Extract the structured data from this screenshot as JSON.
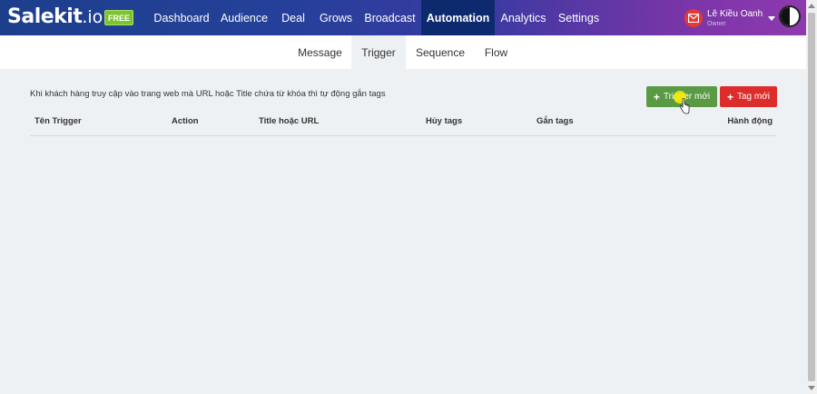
{
  "brand": {
    "name": "Salekit",
    "suffix": ".io",
    "badge": "FREE"
  },
  "nav": {
    "items": [
      {
        "label": "Dashboard"
      },
      {
        "label": "Audience"
      },
      {
        "label": "Deal"
      },
      {
        "label": "Grows"
      },
      {
        "label": "Broadcast"
      },
      {
        "label": "Automation",
        "active": true
      },
      {
        "label": "Analytics"
      },
      {
        "label": "Settings"
      }
    ]
  },
  "user": {
    "name": "Lê Kiều Oanh",
    "role": "Owner"
  },
  "subtabs": [
    {
      "label": "Message"
    },
    {
      "label": "Trigger",
      "active": true
    },
    {
      "label": "Sequence"
    },
    {
      "label": "Flow"
    }
  ],
  "content": {
    "description": "Khi khách hàng truy cập vào trang web mà URL hoặc Title chứa từ khóa thì tự động gắn tags",
    "new_trigger_label": "Trigger mới",
    "new_tag_label": "Tag mới"
  },
  "table": {
    "columns": [
      "Tên Trigger",
      "Action",
      "Title hoặc URL",
      "Hủy tags",
      "Gắn tags",
      "Hành động"
    ],
    "rows": []
  },
  "colors": {
    "accent_green": "#5b9a45",
    "accent_red": "#dd2c2c",
    "badge_green": "#7dc22f",
    "nav_active": "#0e2a6e"
  }
}
